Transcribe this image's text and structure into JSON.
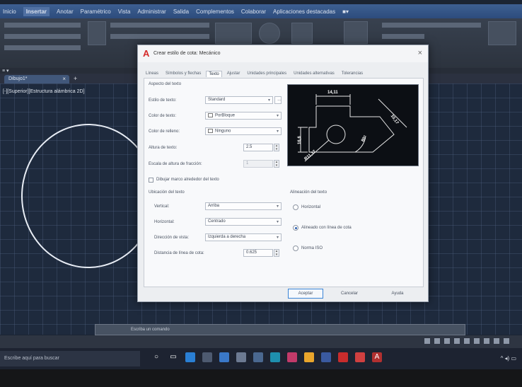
{
  "ribbon": {
    "tabs": [
      "Inicio",
      "Insertar",
      "Anotar",
      "Paramétrico",
      "Vista",
      "Administrar",
      "Salida",
      "Complementos",
      "Colaborar",
      "Aplicaciones destacadas",
      "■▾"
    ]
  },
  "file_tab": {
    "label": "Dibujo1*",
    "close": "×",
    "new": "+"
  },
  "viewport_label": "[-][Superior][Estructura alámbrica 2D]",
  "dialog": {
    "logo": "A",
    "title": "Crear estilo de cota: Mecánico",
    "close": "×",
    "tabs": [
      "Líneas",
      "Símbolos y flechas",
      "Texto",
      "Ajustar",
      "Unidades principales",
      "Unidades alternativas",
      "Tolerancias"
    ],
    "active_tab_index": 2,
    "text_appearance": {
      "heading": "Aspecto del texto",
      "style_label": "Estilo de texto:",
      "style_value": "Standard",
      "color_label": "Color de texto:",
      "color_value": "PorBloque",
      "fill_label": "Color de relleno:",
      "fill_value": "Ninguno",
      "height_label": "Altura de texto:",
      "height_value": "2.5",
      "fraction_label": "Escala de altura de fracción:",
      "fraction_value": "1",
      "frame_label": "Dibujar marco alrededor del texto"
    },
    "text_placement": {
      "heading": "Ubicación del texto",
      "vertical_label": "Vertical:",
      "vertical_value": "Arriba",
      "horizontal_label": "Horizontal:",
      "horizontal_value": "Centrado",
      "view_label": "Dirección de vista:",
      "view_value": "Izquierda a derecha",
      "offset_label": "Distancia de línea de cota:",
      "offset_value": "0.625"
    },
    "text_alignment": {
      "heading": "Alineación del texto",
      "options": [
        "Horizontal",
        "Alineado con línea de cota",
        "Norma ISO"
      ],
      "selected_index": 1
    },
    "preview": {
      "labels": [
        "14,11",
        "16,6",
        "10,17",
        "R11,17",
        "80°"
      ]
    },
    "buttons": {
      "ok": "Aceptar",
      "cancel": "Cancelar",
      "help": "Ayuda"
    }
  },
  "command_line": {
    "placeholder": "Escriba un comando"
  },
  "taskbar": {
    "search_placeholder": "Escribe aquí para buscar",
    "tray": "^ ◂) ▭"
  },
  "colors": {
    "dialog_bg": "#eceef1",
    "accent": "#3a84d6",
    "canvas": "#1e2a3d",
    "autocad_red": "#d52a2a"
  }
}
